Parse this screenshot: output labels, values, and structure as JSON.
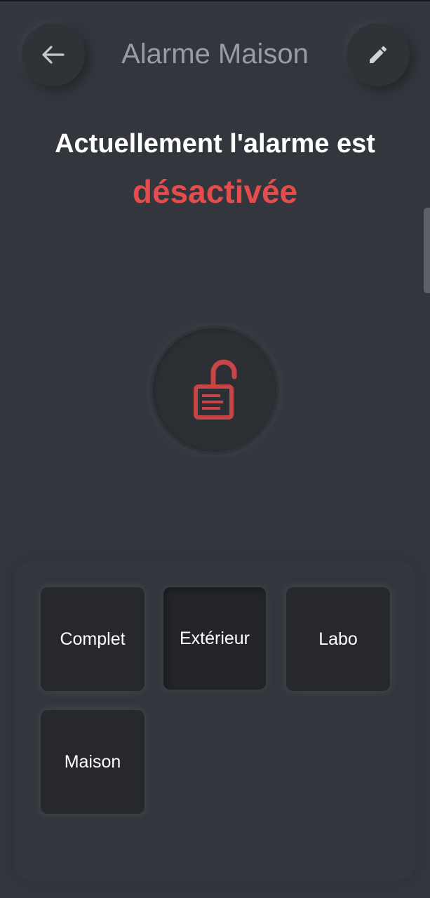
{
  "header": {
    "title": "Alarme Maison",
    "back_icon": "arrow-left-icon",
    "edit_icon": "pencil-icon"
  },
  "status": {
    "line": "Actuellement l'alarme est",
    "state": "désactivée",
    "state_color": "#e74c4c"
  },
  "lock": {
    "icon": "lock-open-icon",
    "color": "#c94444"
  },
  "modes": [
    {
      "label": "Complet"
    },
    {
      "label": "Extérieur"
    },
    {
      "label": "Labo"
    },
    {
      "label": "Maison"
    }
  ]
}
